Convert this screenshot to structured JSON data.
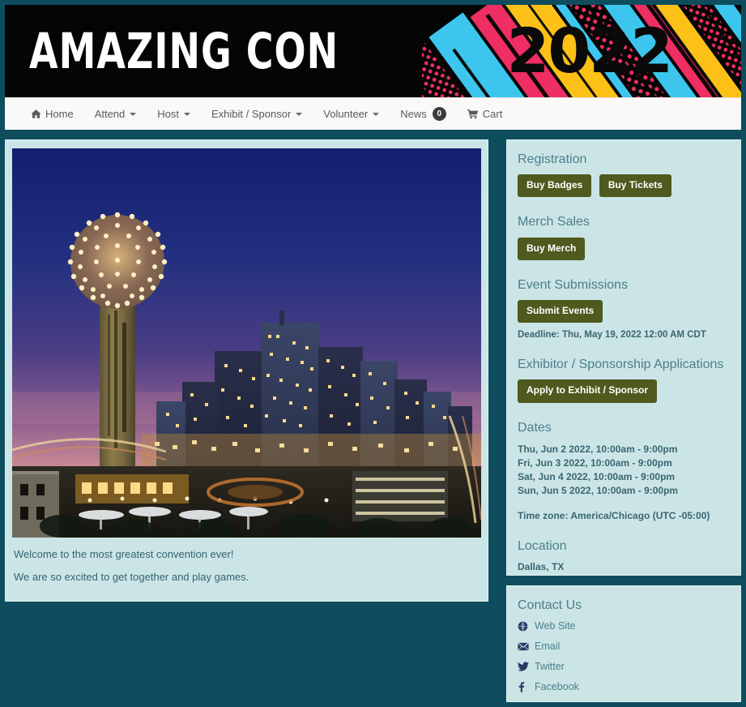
{
  "header": {
    "title": "AMAZING CON",
    "year": "2022"
  },
  "nav": {
    "items": [
      {
        "label": "Home",
        "icon": "home-icon",
        "caret": false,
        "badge": null
      },
      {
        "label": "Attend",
        "icon": null,
        "caret": true,
        "badge": null
      },
      {
        "label": "Host",
        "icon": null,
        "caret": true,
        "badge": null
      },
      {
        "label": "Exhibit / Sponsor",
        "icon": null,
        "caret": true,
        "badge": null
      },
      {
        "label": "Volunteer",
        "icon": null,
        "caret": true,
        "badge": null
      },
      {
        "label": "News",
        "icon": null,
        "caret": false,
        "badge": "0"
      },
      {
        "label": "Cart",
        "icon": "cart-icon",
        "caret": false,
        "badge": null
      }
    ]
  },
  "main": {
    "hero_alt": "Dallas skyline with Reunion Tower at dusk",
    "paragraphs": [
      "Welcome to the most greatest convention ever!",
      "We are so excited to get together and play games."
    ]
  },
  "sidebar": {
    "registration": {
      "heading": "Registration",
      "buttons": [
        "Buy Badges",
        "Buy Tickets"
      ]
    },
    "merch": {
      "heading": "Merch Sales",
      "buttons": [
        "Buy Merch"
      ]
    },
    "submissions": {
      "heading": "Event Submissions",
      "buttons": [
        "Submit Events"
      ],
      "deadline": "Deadline: Thu, May 19, 2022 12:00 AM CDT"
    },
    "exhibitor": {
      "heading": "Exhibitor / Sponsorship Applications",
      "buttons": [
        "Apply to Exhibit / Sponsor"
      ]
    },
    "dates": {
      "heading": "Dates",
      "list": [
        "Thu, Jun 2 2022, 10:00am - 9:00pm",
        "Fri, Jun 3 2022, 10:00am - 9:00pm",
        "Sat, Jun 4 2022, 10:00am - 9:00pm",
        "Sun, Jun 5 2022, 10:00am - 9:00pm"
      ],
      "timezone": "Time zone: America/Chicago (UTC -05:00)"
    },
    "location": {
      "heading": "Location",
      "value": "Dallas, TX"
    },
    "contact": {
      "heading": "Contact Us",
      "links": [
        {
          "label": "Web Site",
          "icon": "globe-icon"
        },
        {
          "label": "Email",
          "icon": "envelope-icon"
        },
        {
          "label": "Twitter",
          "icon": "twitter-icon"
        },
        {
          "label": "Facebook",
          "icon": "facebook-icon"
        }
      ]
    }
  },
  "colors": {
    "page_background": "#0e4d5e",
    "panel_background": "#cbe5e7",
    "button": "#4e5a1e",
    "heading": "#4c7e89",
    "body_text": "#3a6570",
    "banner_background": "#050505",
    "art_cyan": "#3cc6ee",
    "art_yellow": "#fcc017",
    "art_pink": "#ef2e63"
  }
}
